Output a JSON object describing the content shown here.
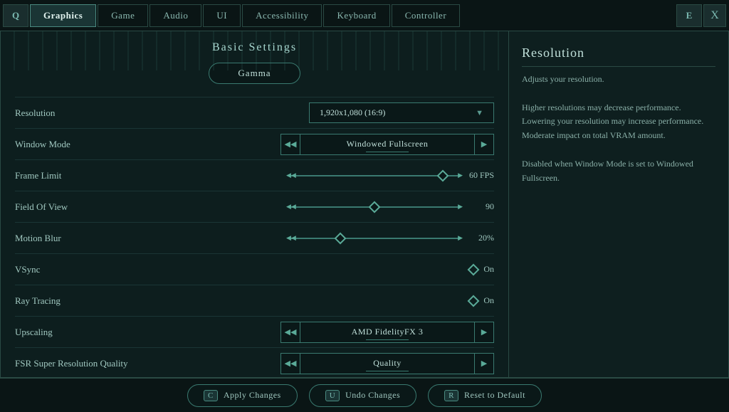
{
  "nav": {
    "left_key": "Q",
    "right_key": "E",
    "close_label": "X",
    "tabs": [
      {
        "label": "Graphics",
        "active": true
      },
      {
        "label": "Game",
        "active": false
      },
      {
        "label": "Audio",
        "active": false
      },
      {
        "label": "UI",
        "active": false
      },
      {
        "label": "Accessibility",
        "active": false
      },
      {
        "label": "Keyboard",
        "active": false
      },
      {
        "label": "Controller",
        "active": false
      }
    ]
  },
  "section": {
    "title": "Basic Settings",
    "gamma_label": "Gamma"
  },
  "settings": [
    {
      "label": "Resolution",
      "type": "dropdown",
      "value": "1,920x1,080 (16:9)"
    },
    {
      "label": "Window Mode",
      "type": "arrow",
      "value": "Windowed Fullscreen"
    },
    {
      "label": "Frame Limit",
      "type": "slider",
      "value": "60 FPS",
      "thumb_pct": 90
    },
    {
      "label": "Field Of View",
      "type": "slider",
      "value": "90",
      "thumb_pct": 50
    },
    {
      "label": "Motion Blur",
      "type": "slider",
      "value": "20%",
      "thumb_pct": 30
    },
    {
      "label": "VSync",
      "type": "toggle",
      "value": "On"
    },
    {
      "label": "Ray Tracing",
      "type": "toggle",
      "value": "On"
    },
    {
      "label": "Upscaling",
      "type": "arrow",
      "value": "AMD FidelityFX 3"
    },
    {
      "label": "FSR Super Resolution Quality",
      "type": "arrow",
      "value": "Quality"
    }
  ],
  "info_panel": {
    "title": "Resolution",
    "text": "Adjusts your resolution.\n\nHigher resolutions may decrease performance. Lowering your resolution may increase performance. Moderate impact on total VRAM amount.\n\nDisabled when Window Mode is set to Windowed Fullscreen."
  },
  "bottom_buttons": [
    {
      "key": "C",
      "label": "Apply Changes"
    },
    {
      "key": "U",
      "label": "Undo Changes"
    },
    {
      "key": "R",
      "label": "Reset to Default"
    }
  ]
}
